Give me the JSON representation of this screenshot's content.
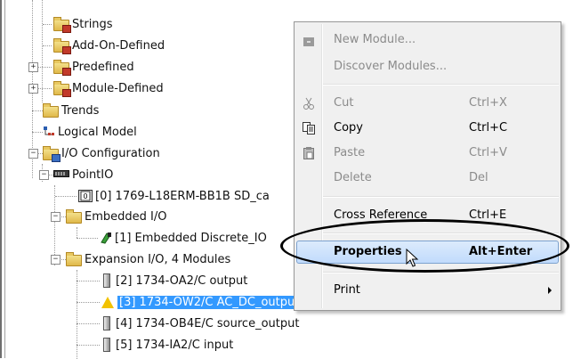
{
  "tree": {
    "items": [
      {
        "label": "Strings"
      },
      {
        "label": "Add-On-Defined"
      },
      {
        "label": "Predefined"
      },
      {
        "label": "Module-Defined"
      },
      {
        "label": "Trends"
      },
      {
        "label": "Logical Model"
      },
      {
        "label": "I/O Configuration"
      },
      {
        "label": "PointIO"
      },
      {
        "label": "[0] 1769-L18ERM-BB1B SD_ca"
      },
      {
        "label": "Embedded I/O"
      },
      {
        "label": "[1] Embedded Discrete_IO"
      },
      {
        "label": "Expansion I/O, 4 Modules"
      },
      {
        "label": "[2] 1734-OA2/C output"
      },
      {
        "label": "[3] 1734-OW2/C AC_DC_output"
      },
      {
        "label": "[4] 1734-OB4E/C source_output"
      },
      {
        "label": "[5] 1734-IA2/C input"
      }
    ],
    "expander_minus": "−",
    "expander_plus": "+"
  },
  "context_menu": {
    "items": [
      {
        "label": "New Module...",
        "shortcut": "",
        "state": "disabled"
      },
      {
        "label": "Discover Modules...",
        "shortcut": "",
        "state": "disabled"
      },
      {
        "label": "Cut",
        "shortcut": "Ctrl+X",
        "state": "disabled"
      },
      {
        "label": "Copy",
        "shortcut": "Ctrl+C",
        "state": "enabled"
      },
      {
        "label": "Paste",
        "shortcut": "Ctrl+V",
        "state": "disabled"
      },
      {
        "label": "Delete",
        "shortcut": "Del",
        "state": "disabled"
      },
      {
        "label": "Cross Reference",
        "shortcut": "Ctrl+E",
        "state": "enabled"
      },
      {
        "label": "Properties",
        "shortcut": "Alt+Enter",
        "state": "highlighted"
      },
      {
        "label": "Print",
        "shortcut": "",
        "state": "enabled"
      }
    ]
  },
  "colors": {
    "selection": "#3399ff",
    "menu_highlight": "#c1dbfc",
    "warning": "#f2c200",
    "folder": "#e0b84a"
  }
}
